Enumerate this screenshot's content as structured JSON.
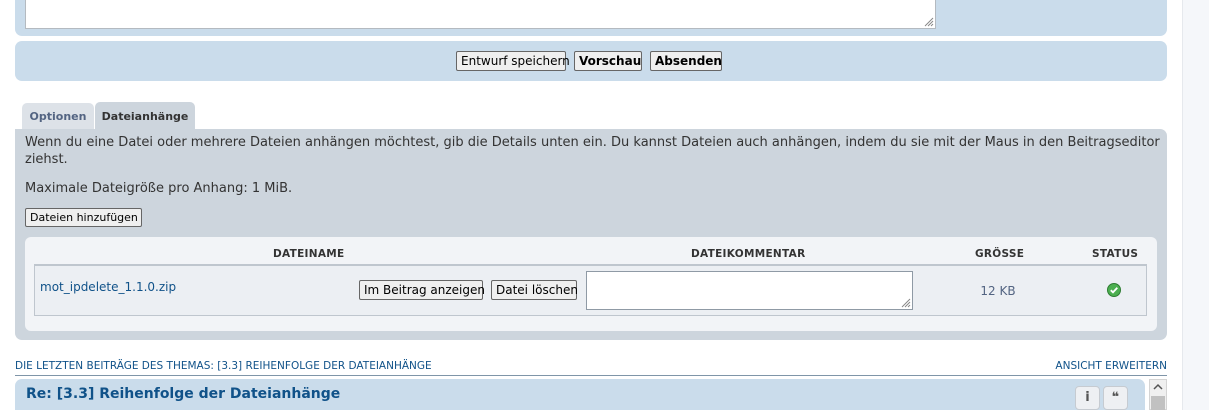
{
  "buttons": {
    "save_draft": "Entwurf speichern",
    "preview": "Vorschau",
    "submit": "Absenden"
  },
  "tabs": [
    {
      "label": "Optionen",
      "active": false
    },
    {
      "label": "Dateianhänge",
      "active": true
    }
  ],
  "attachments": {
    "intro_line1": "Wenn du eine Datei oder mehrere Dateien anhängen möchtest, gib die Details unten ein. Du kannst Dateien auch anhängen, indem du sie mit der Maus in den Beitragseditor",
    "intro_line2": "ziehst.",
    "max_size": "Maximale Dateigröße pro Anhang: 1 MiB.",
    "add_button": "Dateien hinzufügen",
    "columns": {
      "filename": "DATEINAME",
      "comment": "DATEIKOMMENTAR",
      "size": "GRÖSSE",
      "status": "STATUS"
    },
    "files": [
      {
        "name": "mot_ipdelete_1.1.0.zip",
        "show_inline": "Im Beitrag anzeigen",
        "delete": "Datei löschen",
        "comment": "",
        "size": "12 KB",
        "status": "ok"
      }
    ]
  },
  "review": {
    "title": "DIE LETZTEN BEITRÄGE DES THEMAS: [3.3] REIHENFOLGE DER DATEIANHÄNGE",
    "expand": "ANSICHT ERWEITERN",
    "post_title": "Re: [3.3] Reihenfolge der Dateianhänge",
    "info_glyph": "i",
    "quote_glyph": "❝"
  },
  "colors": {
    "panel_blue": "#cadceb",
    "panel_grey": "#cdd5dd",
    "link_blue": "#105289",
    "status_green": "#4caf50"
  }
}
